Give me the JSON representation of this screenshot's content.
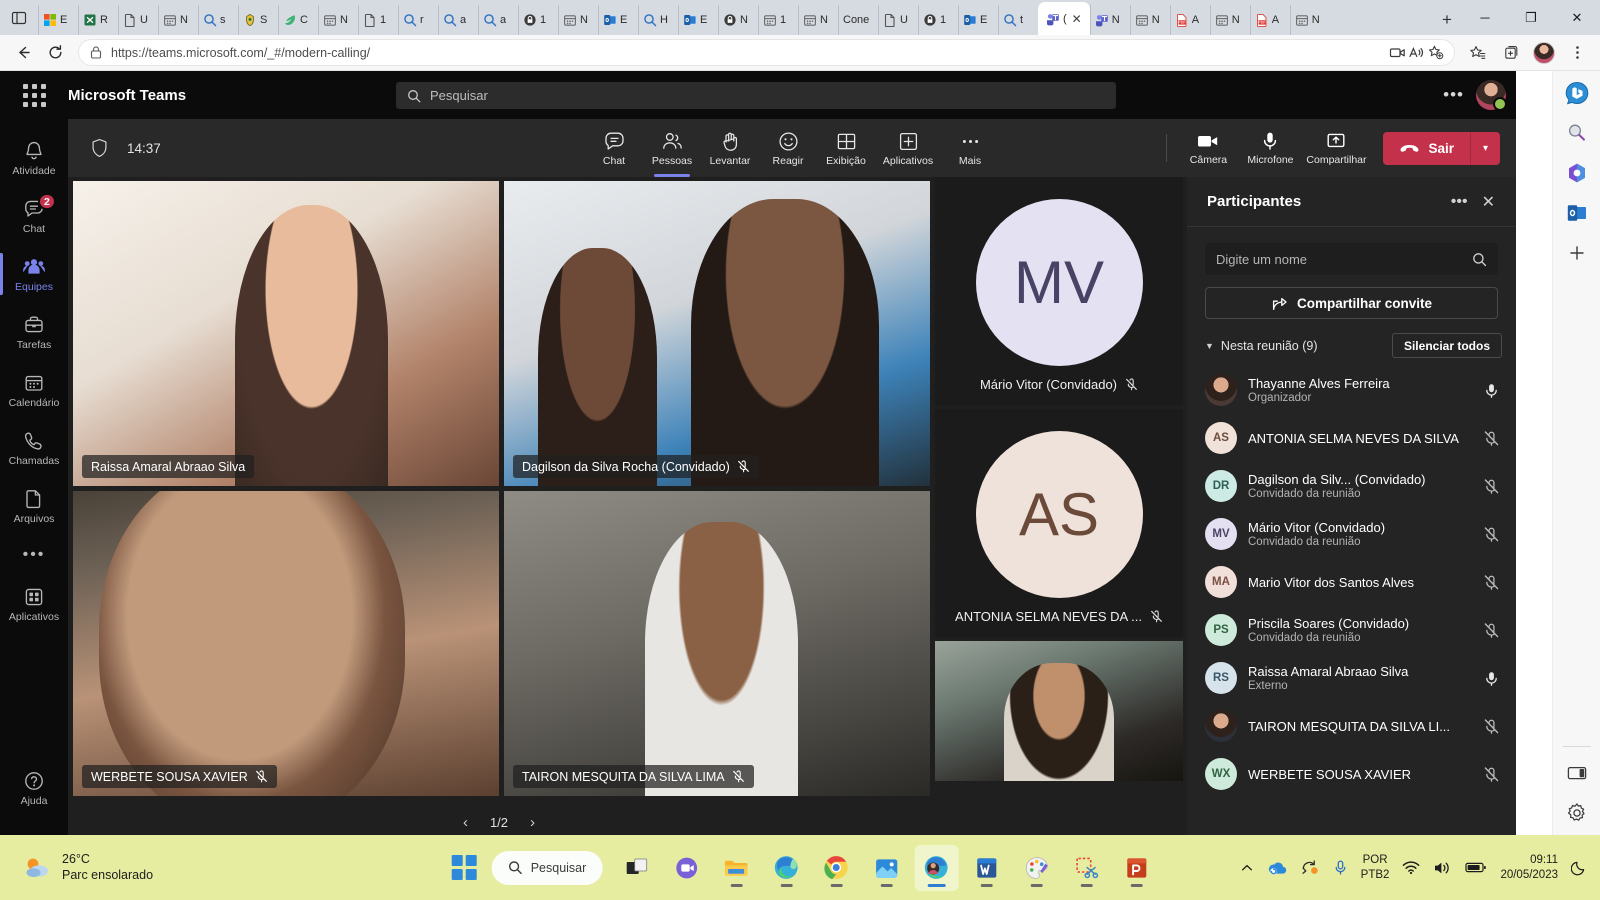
{
  "browser": {
    "url": "https://teams.microsoft.com/_#/modern-calling/",
    "tabs": [
      {
        "label": "E",
        "icon": "ms-office-icon"
      },
      {
        "label": "R",
        "icon": "excel-icon"
      },
      {
        "label": "U",
        "icon": "doc-icon"
      },
      {
        "label": "N",
        "icon": "calendar-icon"
      },
      {
        "label": "s",
        "icon": "search-icon"
      },
      {
        "label": "S",
        "icon": "gov-icon"
      },
      {
        "label": "C",
        "icon": "leaf-icon"
      },
      {
        "label": "N",
        "icon": "calendar-icon"
      },
      {
        "label": "1",
        "icon": "doc-icon"
      },
      {
        "label": "r",
        "icon": "search-icon"
      },
      {
        "label": "a",
        "icon": "search-icon"
      },
      {
        "label": "a",
        "icon": "search-icon"
      },
      {
        "label": "1",
        "icon": "lock-icon"
      },
      {
        "label": "N",
        "icon": "calendar-icon"
      },
      {
        "label": "E",
        "icon": "outlook-icon"
      },
      {
        "label": "H",
        "icon": "search-icon"
      },
      {
        "label": "E",
        "icon": "outlook-icon"
      },
      {
        "label": "N",
        "icon": "lock-icon"
      },
      {
        "label": "1",
        "icon": "calendar-icon"
      },
      {
        "label": "N",
        "icon": "calendar-icon"
      },
      {
        "label": "Cone",
        "icon": "none"
      },
      {
        "label": "U",
        "icon": "doc-icon"
      },
      {
        "label": "1",
        "icon": "lock-icon"
      },
      {
        "label": "E",
        "icon": "outlook-icon"
      },
      {
        "label": "t",
        "icon": "search-icon"
      },
      {
        "label": "(",
        "icon": "teams-icon",
        "active": true
      },
      {
        "label": "N",
        "icon": "teams-icon"
      },
      {
        "label": "N",
        "icon": "calendar-icon"
      },
      {
        "label": "A",
        "icon": "pdf-icon"
      },
      {
        "label": "N",
        "icon": "calendar-icon"
      },
      {
        "label": "A",
        "icon": "pdf-icon"
      },
      {
        "label": "N",
        "icon": "calendar-icon"
      }
    ],
    "new_tab_label": "+",
    "window_minimize": "─",
    "window_restore": "❐",
    "window_close": "✕"
  },
  "teams": {
    "app_title": "Microsoft Teams",
    "search_placeholder": "Pesquisar",
    "header_more": "•••",
    "rail": [
      {
        "label": "Atividade",
        "icon": "bell-icon",
        "badge": null,
        "active": false
      },
      {
        "label": "Chat",
        "icon": "chat-icon",
        "badge": "2",
        "active": false
      },
      {
        "label": "Equipes",
        "icon": "teams-people-icon",
        "badge": null,
        "active": true
      },
      {
        "label": "Tarefas",
        "icon": "tasks-icon",
        "badge": null,
        "active": false
      },
      {
        "label": "Calendário",
        "icon": "calendar-icon",
        "badge": null,
        "active": false
      },
      {
        "label": "Chamadas",
        "icon": "phone-icon",
        "badge": null,
        "active": false
      },
      {
        "label": "Arquivos",
        "icon": "file-icon",
        "badge": null,
        "active": false
      }
    ],
    "rail_more": "•••",
    "rail_apps": {
      "label": "Aplicativos",
      "icon": "apps-grid-icon"
    },
    "rail_help": {
      "label": "Ajuda",
      "icon": "help-icon"
    }
  },
  "meeting": {
    "elapsed_time": "14:37",
    "shield_icon": "shield-icon",
    "controls": [
      {
        "label": "Chat",
        "icon": "chat-icon",
        "active": false
      },
      {
        "label": "Pessoas",
        "icon": "people-icon",
        "active": true
      },
      {
        "label": "Levantar",
        "icon": "raise-hand-icon",
        "active": false
      },
      {
        "label": "Reagir",
        "icon": "emoji-icon",
        "active": false
      },
      {
        "label": "Exibição",
        "icon": "layout-icon",
        "active": false
      },
      {
        "label": "Aplicativos",
        "icon": "plus-box-icon",
        "active": false
      },
      {
        "label": "Mais",
        "icon": "more-dots-icon",
        "active": false
      }
    ],
    "device_controls": [
      {
        "label": "Câmera",
        "icon": "camera-icon"
      },
      {
        "label": "Microfone",
        "icon": "microphone-icon"
      },
      {
        "label": "Compartilhar",
        "icon": "share-screen-icon"
      }
    ],
    "leave_label": "Sair",
    "leave_icon": "hangup-icon",
    "leave_caret": "▾",
    "leave_color": "#c4314b",
    "accent_color": "#7b83eb",
    "pagination": {
      "current": "1/2",
      "prev": "‹",
      "next": "›"
    }
  },
  "tiles": [
    {
      "name": "Raissa Amaral Abraao Silva",
      "muted": false,
      "kind": "video",
      "bg1": "#f2ece4",
      "bg2": "#c7a489"
    },
    {
      "name": "Dagilson da Silva Rocha (Convidado)",
      "muted": true,
      "kind": "video",
      "bg1": "#dfe3e6",
      "bg2": "#4a3b35"
    },
    {
      "name": "WERBETE SOUSA XAVIER",
      "muted": true,
      "kind": "video",
      "bg1": "#a08775",
      "bg2": "#3e3028"
    },
    {
      "name": "TAIRON MESQUITA DA SILVA LIMA",
      "muted": true,
      "kind": "video",
      "bg1": "#8c8c86",
      "bg2": "#3a3a38"
    }
  ],
  "avatar_tiles": [
    {
      "name": "Mário Vitor (Convidado)",
      "initials": "MV",
      "muted": true,
      "bg": "#e4e1f2",
      "fg": "#4a4264"
    },
    {
      "name": "ANTONIA SELMA NEVES DA ...",
      "initials": "AS",
      "muted": true,
      "bg": "#efe2da",
      "fg": "#6b4a3a"
    }
  ],
  "self_tile": {
    "name": "",
    "kind": "video"
  },
  "participants_panel": {
    "title": "Participantes",
    "more_icon": "•••",
    "close_icon": "✕",
    "search_placeholder": "Digite um nome",
    "search_icon": "search-icon",
    "invite_label": "Compartilhar convite",
    "invite_icon": "share-invite-icon",
    "section_label": "Nesta reunião (9)",
    "mute_all_label": "Silenciar todos",
    "people": [
      {
        "name": "Thayanne Alves Ferreira",
        "role": "Organizador",
        "initials": "",
        "avatar_type": "photo",
        "bg": "#4a3a35",
        "fg": "#ffffff",
        "muted": false
      },
      {
        "name": "ANTONIA SELMA NEVES DA SILVA",
        "role": "",
        "initials": "AS",
        "avatar_type": "initials",
        "bg": "#f0e2d8",
        "fg": "#6d4c3b",
        "muted": true
      },
      {
        "name": "Dagilson da Silv...  (Convidado)",
        "role": "Convidado da reunião",
        "initials": "DR",
        "avatar_type": "initials",
        "bg": "#cdeae4",
        "fg": "#2d6158",
        "muted": true
      },
      {
        "name": "Mário Vitor (Convidado)",
        "role": "Convidado da reunião",
        "initials": "MV",
        "avatar_type": "initials",
        "bg": "#e4e0f2",
        "fg": "#4c4468",
        "muted": true
      },
      {
        "name": "Mario Vitor dos Santos Alves",
        "role": "",
        "initials": "MA",
        "avatar_type": "initials",
        "bg": "#f1dfd9",
        "fg": "#7a4f42",
        "muted": true
      },
      {
        "name": "Priscila Soares (Convidado)",
        "role": "Convidado da reunião",
        "initials": "PS",
        "avatar_type": "initials",
        "bg": "#cdeada",
        "fg": "#2f6342",
        "muted": true
      },
      {
        "name": "Raissa Amaral Abraao Silva",
        "role": "Externo",
        "initials": "RS",
        "avatar_type": "initials",
        "bg": "#d6e3ea",
        "fg": "#3a5668",
        "muted": false
      },
      {
        "name": "TAIRON MESQUITA DA SILVA LI...",
        "role": "",
        "initials": "",
        "avatar_type": "photo",
        "bg": "#2c3038",
        "fg": "#ffffff",
        "muted": true
      },
      {
        "name": "WERBETE SOUSA XAVIER",
        "role": "",
        "initials": "WX",
        "avatar_type": "initials",
        "bg": "#cdeada",
        "fg": "#2f6342",
        "muted": true
      }
    ]
  },
  "taskbar": {
    "weather": {
      "temp": "26°C",
      "condition": "Parc ensolarado",
      "icon": "partly-sunny-icon"
    },
    "start_label": "start-button",
    "search_placeholder": "Pesquisar",
    "apps": [
      {
        "name": "task-view",
        "running": false
      },
      {
        "name": "teams-chat",
        "running": false
      },
      {
        "name": "file-explorer",
        "running": true
      },
      {
        "name": "microsoft-edge",
        "running": true
      },
      {
        "name": "google-chrome",
        "running": true
      },
      {
        "name": "photos",
        "running": true
      },
      {
        "name": "microsoft-edge-teams",
        "running": true,
        "active": true
      },
      {
        "name": "microsoft-word",
        "running": true
      },
      {
        "name": "paint",
        "running": true
      },
      {
        "name": "snipping-tool",
        "running": true
      },
      {
        "name": "powerpoint",
        "running": true
      }
    ],
    "tray": {
      "chevron": "⌃",
      "language_line1": "POR",
      "language_line2": "PTB2",
      "time": "09:11",
      "date": "20/05/2023"
    }
  }
}
